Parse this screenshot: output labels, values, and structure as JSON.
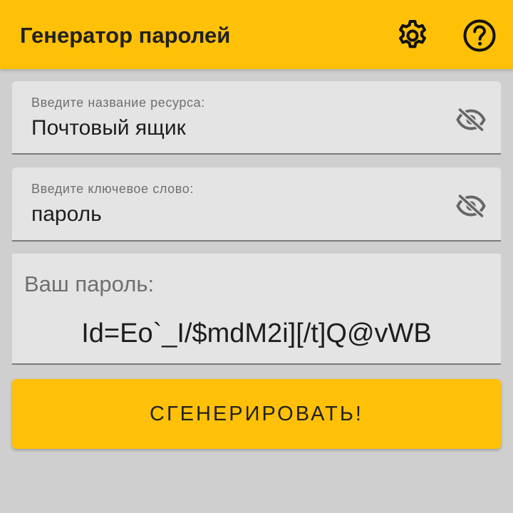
{
  "app_bar": {
    "title": "Генератор паролей",
    "settings_icon": "gear-icon",
    "help_icon": "question-circle-icon",
    "background_color": "#ffc107"
  },
  "resource_field": {
    "label": "Введите название ресурса:",
    "value": "Почтовый ящик",
    "toggle_icon": "eye-off-icon"
  },
  "keyword_field": {
    "label": "Введите ключевое слово:",
    "value": "пароль",
    "toggle_icon": "eye-off-icon"
  },
  "result": {
    "label": "Ваш пароль:",
    "value": "Id=Eo`_I/$mdM2i][/t]Q@vWB"
  },
  "generate_button": {
    "label": "СГЕНЕРИРОВАТЬ!",
    "color": "#ffc107"
  }
}
